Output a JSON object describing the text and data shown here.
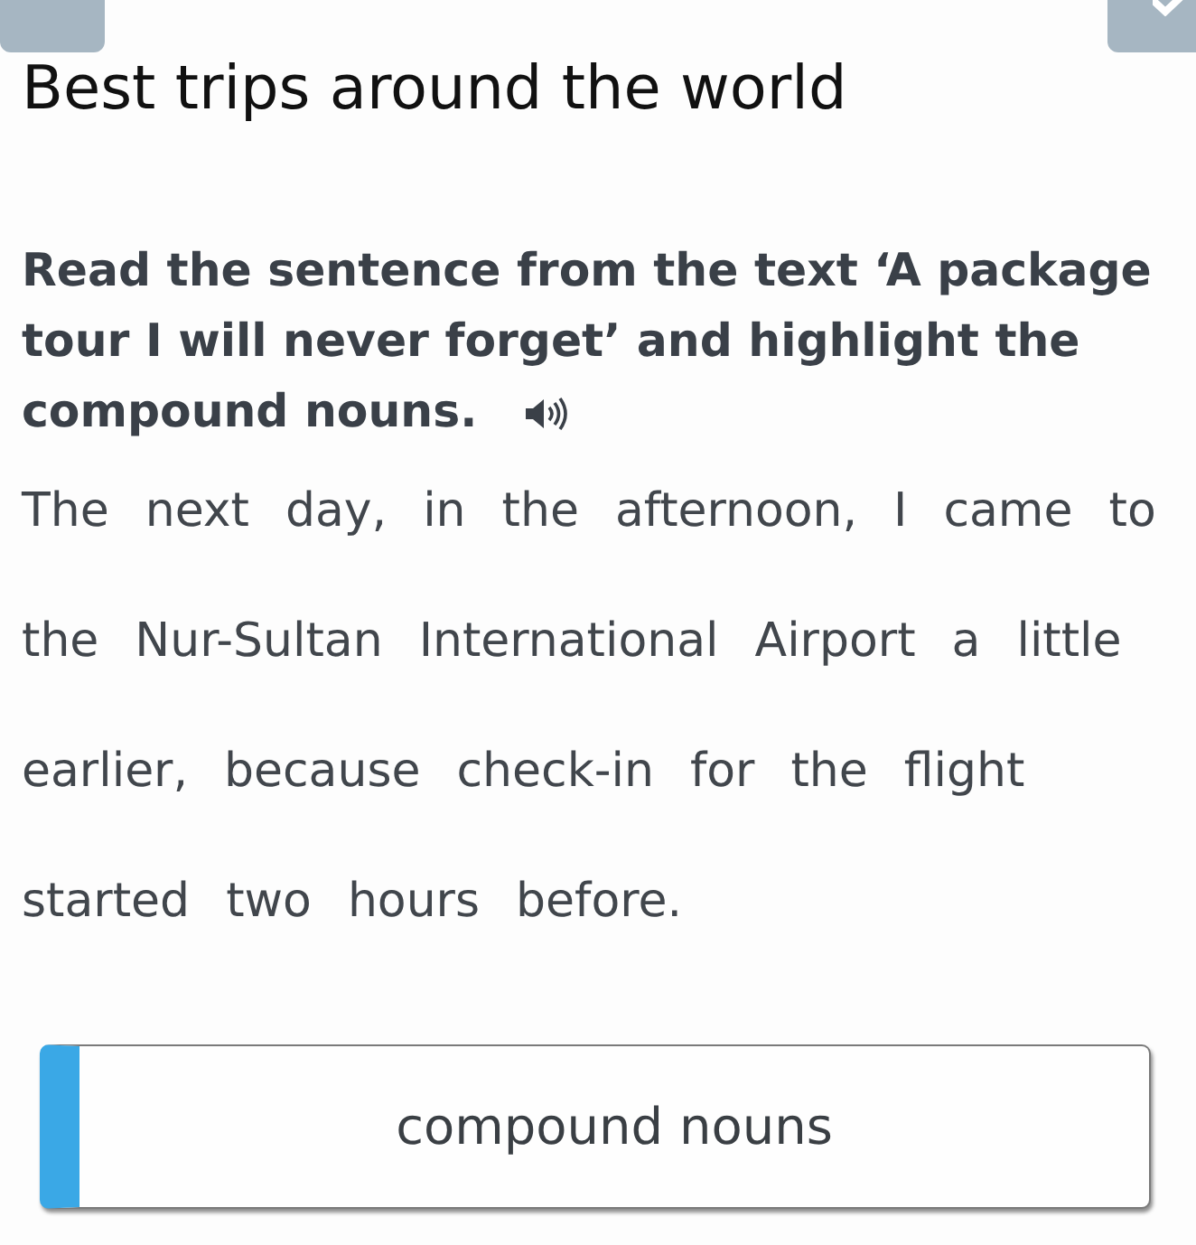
{
  "top_buttons": [
    {
      "kind": "plain"
    },
    {
      "kind": "check"
    }
  ],
  "title": "Best trips around the world",
  "task": {
    "instruction": "Read the sentence from the text ‘A package tour I will never forget’ and highlight the compound nouns."
  },
  "sentence": {
    "words": [
      "The",
      "next",
      "day,",
      "in",
      "the",
      "afternoon,",
      "I",
      "came",
      "to",
      "the",
      "Nur-Sultan",
      "International",
      "Airport",
      "a",
      "little",
      "earlier,",
      "because",
      "check-in",
      "for",
      "the",
      "flight",
      "started",
      "two",
      "hours",
      "before."
    ]
  },
  "categories": [
    {
      "label": "compound nouns"
    }
  ]
}
